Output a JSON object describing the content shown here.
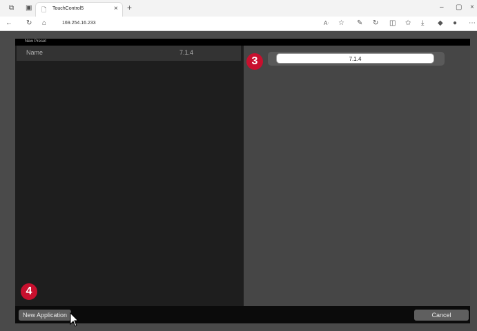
{
  "browser": {
    "tab_title": "TouchControl5",
    "tab_close": "×",
    "new_tab": "+",
    "url": "169.254.16.233",
    "window_controls": {
      "minimize": "–",
      "restore": "▢",
      "close": "×"
    }
  },
  "app": {
    "header_title": "New Preset",
    "row": {
      "label": "Name",
      "value": "7.1.4"
    },
    "name_input_value": "7.1.4",
    "buttons": {
      "new_application": "New Application",
      "cancel": "Cancel"
    },
    "badges": {
      "step3": "3",
      "step4": "4"
    }
  },
  "colors": {
    "badge": "#c8102e"
  }
}
